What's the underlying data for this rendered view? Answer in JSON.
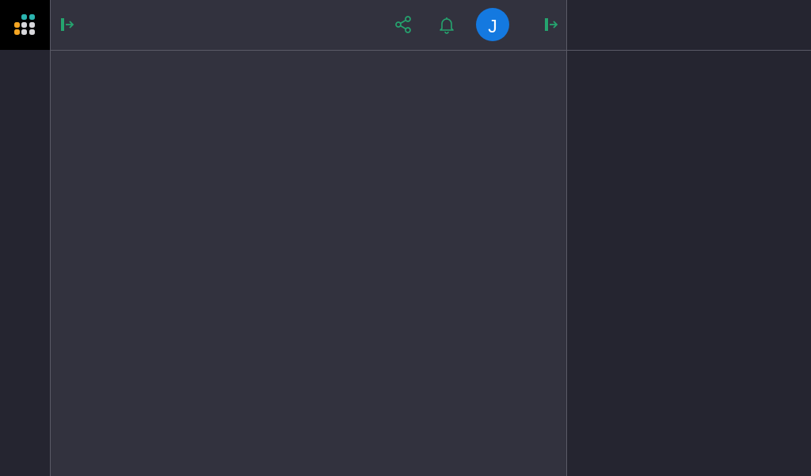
{
  "colors": {
    "accent": "#25a46f",
    "avatar_bg": "#1479e0",
    "logo_orange": "#f5a623",
    "logo_teal": "#2bb5b0",
    "logo_gray": "#d8d8dc"
  },
  "header": {
    "collapse_icon": "collapse-sidebar-icon",
    "share_icon": "share-icon",
    "notifications_icon": "bell-icon",
    "user_avatar_initial": "J",
    "expand_icon": "collapse-panel-icon"
  },
  "logo": {
    "icon": "app-logo-icon"
  }
}
